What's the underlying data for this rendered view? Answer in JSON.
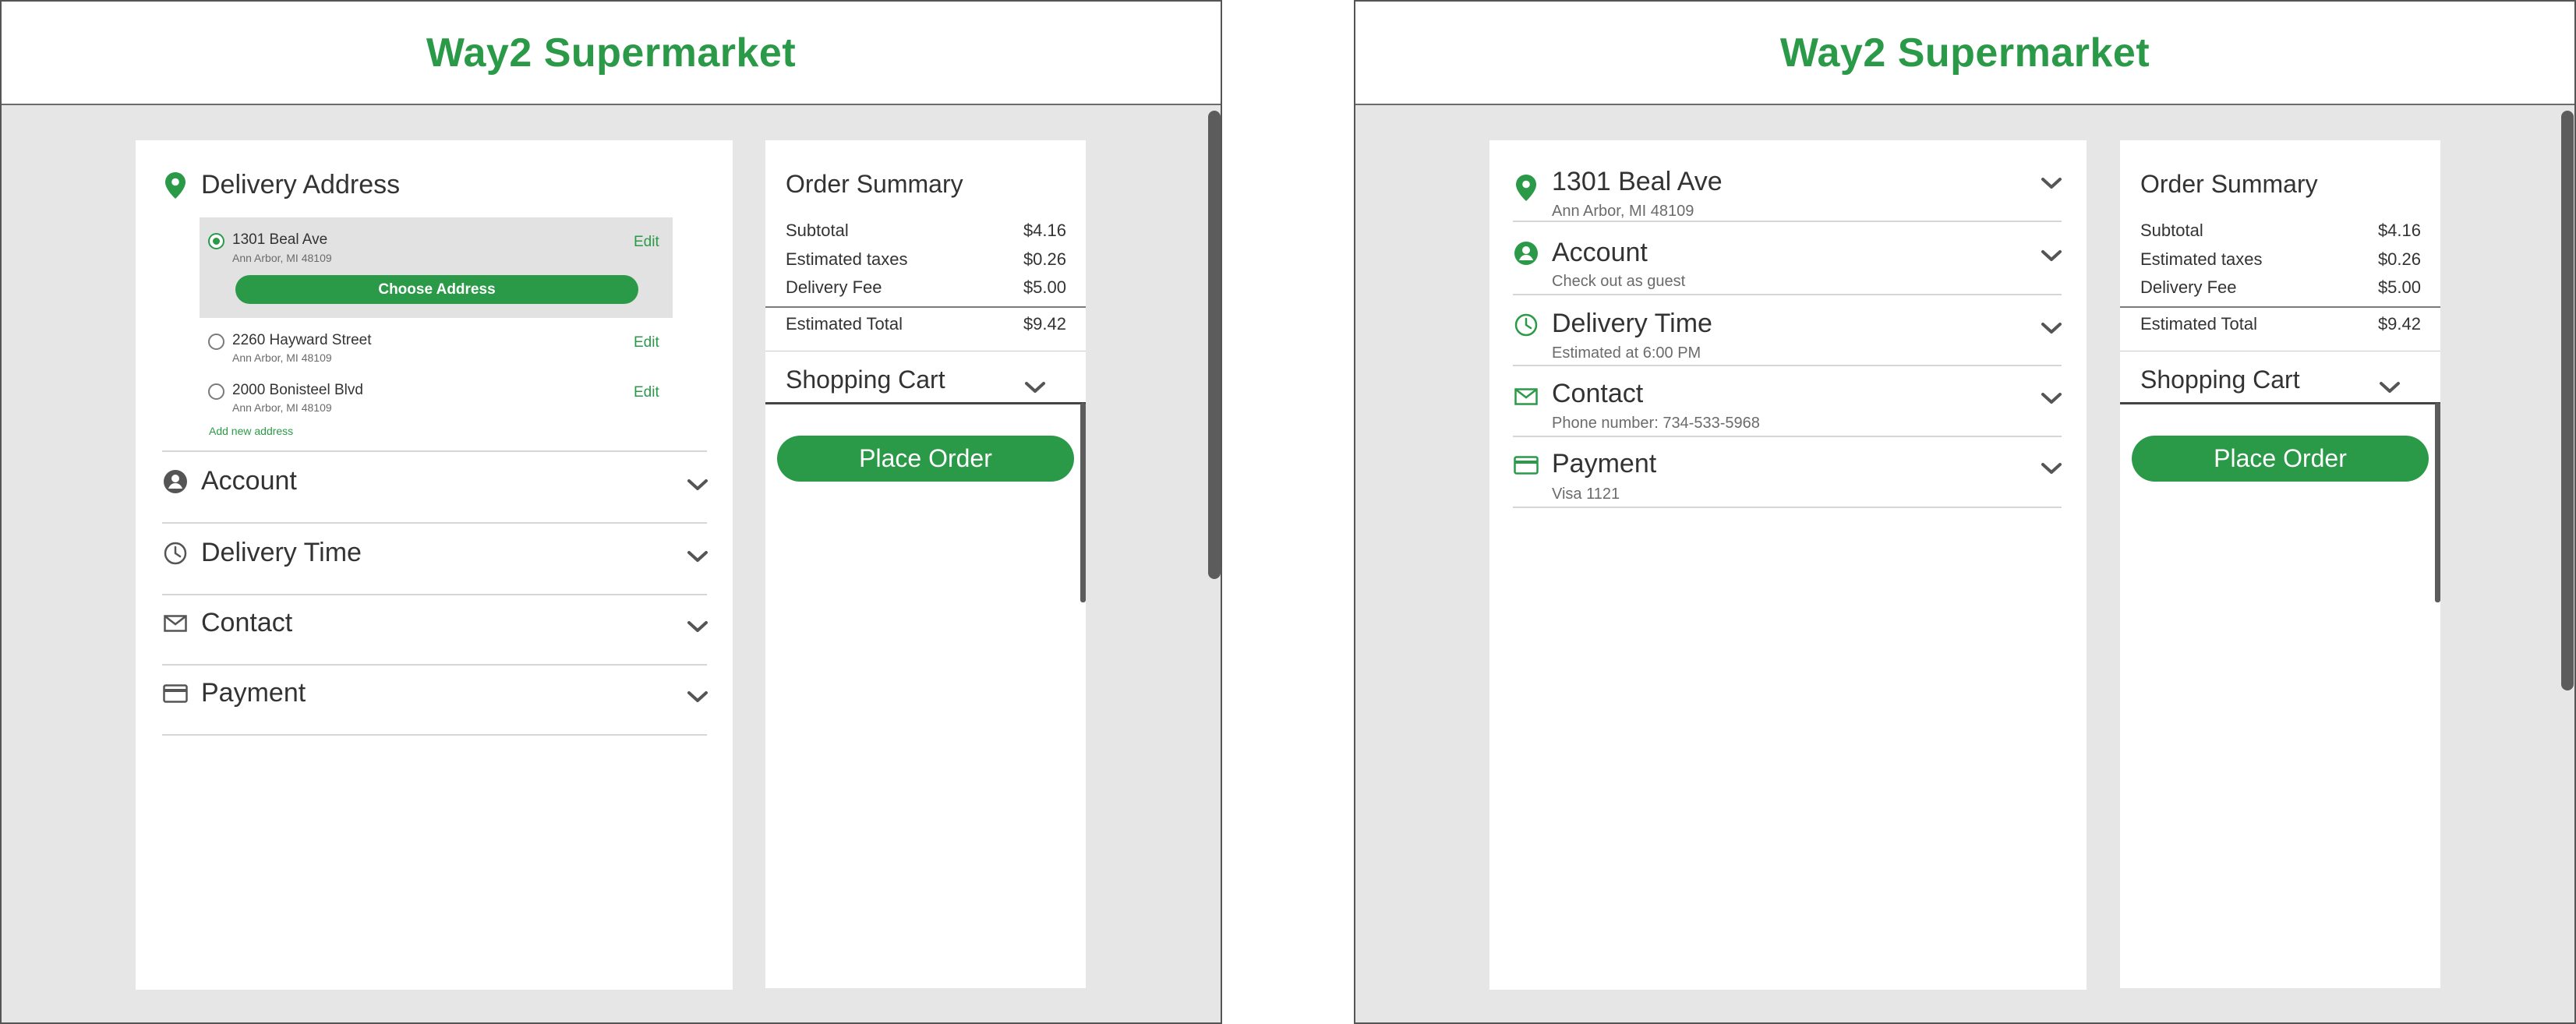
{
  "brand": {
    "name": "Way2 Supermarket",
    "color": "#2b9a48"
  },
  "checkout_expanded": {
    "delivery_address": {
      "title": "Delivery Address",
      "icon": "map-pin-icon",
      "addresses": [
        {
          "line1": "1301 Beal Ave",
          "line2": "Ann Arbor, MI 48109",
          "selected": true,
          "edit_label": "Edit"
        },
        {
          "line1": "2260 Hayward Street",
          "line2": "Ann Arbor, MI 48109",
          "selected": false,
          "edit_label": "Edit"
        },
        {
          "line1": "2000 Bonisteel Blvd",
          "line2": "Ann Arbor, MI 48109",
          "selected": false,
          "edit_label": "Edit"
        }
      ],
      "choose_button": "Choose Address",
      "add_new_link": "Add new address"
    },
    "sections": [
      {
        "title": "Account",
        "icon": "user-circle-icon"
      },
      {
        "title": "Delivery Time",
        "icon": "clock-icon"
      },
      {
        "title": "Contact",
        "icon": "envelope-icon"
      },
      {
        "title": "Payment",
        "icon": "credit-card-icon"
      }
    ]
  },
  "checkout_collapsed": {
    "sections": [
      {
        "title": "1301 Beal Ave",
        "subtitle": "Ann Arbor, MI 48109",
        "icon": "map-pin-icon"
      },
      {
        "title": "Account",
        "subtitle": "Check out as guest",
        "icon": "user-circle-icon"
      },
      {
        "title": "Delivery Time",
        "subtitle": "Estimated at 6:00 PM",
        "icon": "clock-icon"
      },
      {
        "title": "Contact",
        "subtitle": "Phone number: 734-533-5968",
        "icon": "envelope-icon"
      },
      {
        "title": "Payment",
        "subtitle": "Visa 1121",
        "icon": "credit-card-icon"
      }
    ]
  },
  "order_summary": {
    "title": "Order Summary",
    "rows": [
      {
        "label": "Subtotal",
        "value": "$4.16"
      },
      {
        "label": "Estimated taxes",
        "value": "$0.26"
      },
      {
        "label": "Delivery Fee",
        "value": "$5.00"
      }
    ],
    "total": {
      "label": "Estimated Total",
      "value": "$9.42"
    },
    "cart_label": "Shopping Cart",
    "place_order": "Place Order"
  }
}
